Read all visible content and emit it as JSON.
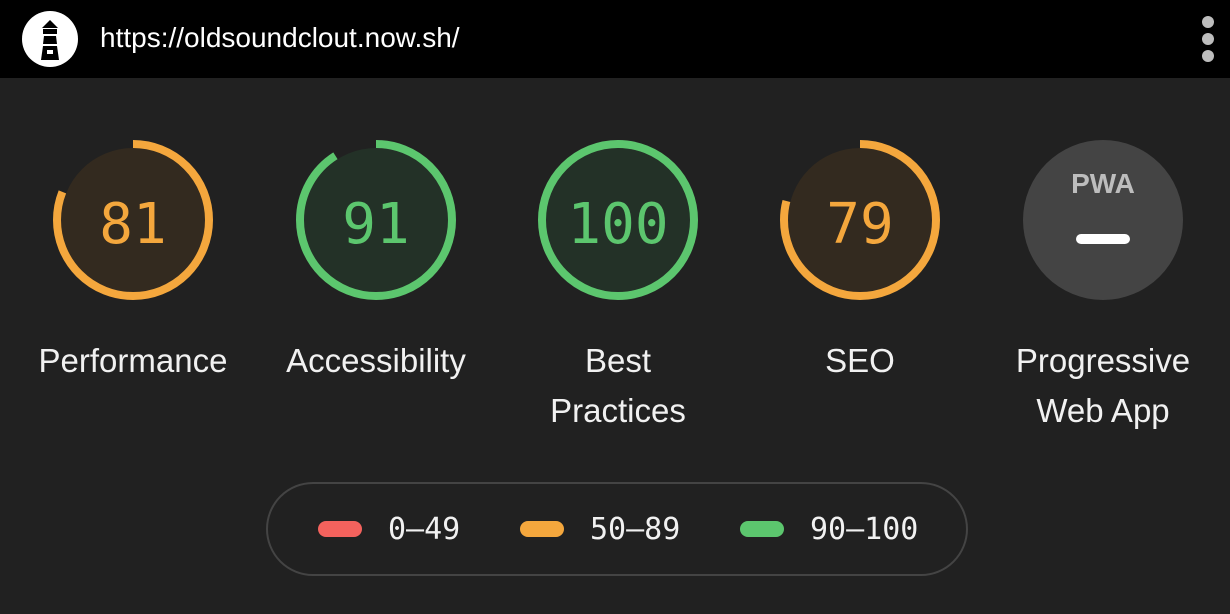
{
  "header": {
    "url": "https://oldsoundclout.now.sh/",
    "logo_icon": "lighthouse-icon",
    "menu_icon": "more-vertical-icon"
  },
  "colors": {
    "fail": "#f4625d",
    "average": "#f4a73d",
    "pass": "#5cc66e",
    "track_average": "#332a1f",
    "track_pass": "#233127",
    "pwa_bg": "#444444"
  },
  "gauges": [
    {
      "label": "Performance",
      "score": "81",
      "fraction": 0.81,
      "rating": "average"
    },
    {
      "label": "Accessibility",
      "score": "91",
      "fraction": 0.91,
      "rating": "pass"
    },
    {
      "label_line1": "Best",
      "label_line2": "Practices",
      "score": "100",
      "fraction": 1.0,
      "rating": "pass"
    },
    {
      "label": "SEO",
      "score": "79",
      "fraction": 0.79,
      "rating": "average"
    }
  ],
  "pwa": {
    "badge_text": "PWA",
    "label_line1": "Progressive",
    "label_line2": "Web App"
  },
  "legend": [
    {
      "range": "0–49",
      "rating": "fail"
    },
    {
      "range": "50–89",
      "rating": "average"
    },
    {
      "range": "90–100",
      "rating": "pass"
    }
  ]
}
